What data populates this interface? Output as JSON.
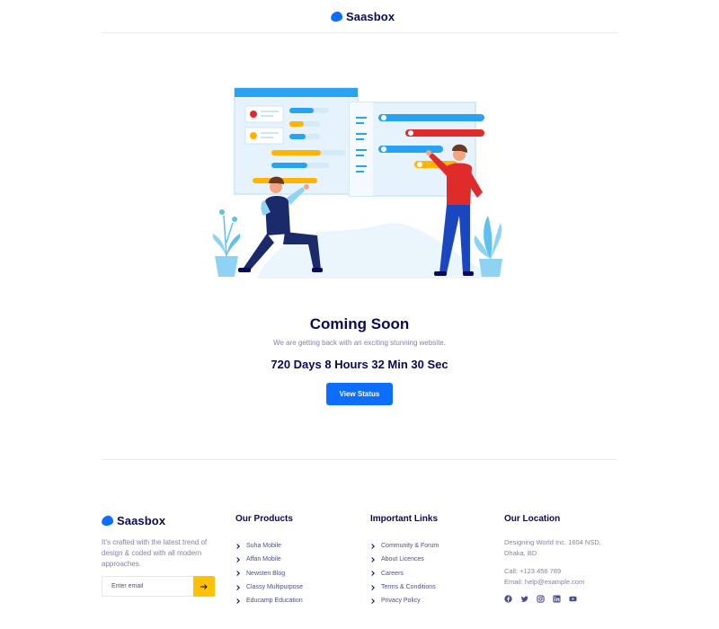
{
  "brand": {
    "name": "Saasbox",
    "color": "#0d6efd"
  },
  "hero": {
    "title": "Coming Soon",
    "subtitle": "We are getting back with an exciting stunning website.",
    "countdown": "720 Days 8 Hours 32 Min 30 Sec",
    "button_label": "View Status"
  },
  "footer": {
    "description": "It's crafted with the latest trend of design & coded with all modern approaches.",
    "newsletter": {
      "placeholder": "Enter email",
      "submit_icon": "arrow-right-icon"
    },
    "products": {
      "title": "Our Products",
      "items": [
        "Suha Mobile",
        "Affan Mobile",
        "Newsten Blog",
        "Classy Multipurpose",
        "Educamp Education"
      ]
    },
    "links": {
      "title": "Important Links",
      "items": [
        "Community & Forum",
        "About Licences",
        "Careers",
        "Terms & Conditions",
        "Privacy Policy"
      ]
    },
    "location": {
      "title": "Our Location",
      "address_line1": "Designing World Inc. 1604 NSD,",
      "address_line2": "Dhaka, BD",
      "phone": "Call: +123 456 789",
      "email": "Email: help@example.com"
    },
    "socials": [
      "facebook-icon",
      "twitter-icon",
      "instagram-icon",
      "linkedin-icon",
      "youtube-icon"
    ]
  },
  "colors": {
    "primary": "#0d6efd",
    "accent": "#ffc107",
    "heading": "#070a57",
    "muted": "#8480ae",
    "red": "#e02b2b",
    "sky": "#27a3f2"
  }
}
